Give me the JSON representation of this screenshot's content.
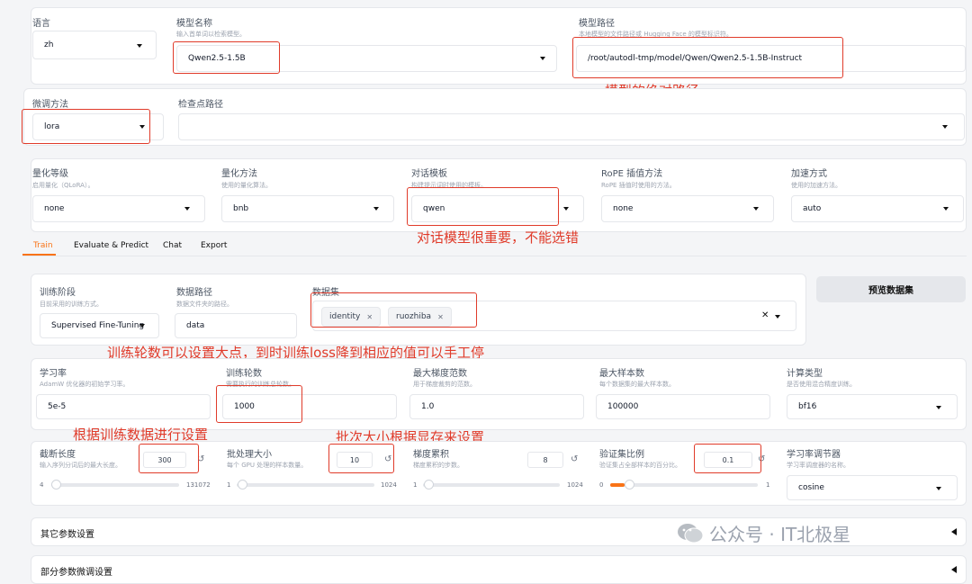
{
  "row1": {
    "lang_label": "语言",
    "lang_value": "zh",
    "model_name_label": "模型名称",
    "model_name_hint": "输入首单词以检索模型。",
    "model_name_value": "Qwen2.5-1.5B",
    "model_path_label": "模型路径",
    "model_path_hint": "本地模型的文件路径或 Hugging Face 的模型标识符。",
    "model_path_value": "/root/autodl-tmp/model/Qwen/Qwen2.5-1.5B-Instruct"
  },
  "row2": {
    "finetune_label": "微调方法",
    "finetune_value": "lora",
    "checkpoint_label": "检查点路径"
  },
  "row3": {
    "quant_label": "量化等级",
    "quant_hint": "启用量化（QLoRA）。",
    "quant_value": "none",
    "quant_method_label": "量化方法",
    "quant_method_hint": "使用的量化算法。",
    "quant_method_value": "bnb",
    "template_label": "对话模板",
    "template_hint": "构建提示词时使用的模板。",
    "template_value": "qwen",
    "rope_label": "RoPE 插值方法",
    "rope_hint": "RoPE 插值时使用的方法。",
    "rope_value": "none",
    "accel_label": "加速方式",
    "accel_hint": "使用的加速方法。",
    "accel_value": "auto"
  },
  "tabs": [
    "Train",
    "Evaluate & Predict",
    "Chat",
    "Export"
  ],
  "train": {
    "stage_label": "训练阶段",
    "stage_hint": "目前采用的训练方式。",
    "stage_value": "Supervised Fine-Tuning",
    "data_dir_label": "数据路径",
    "data_dir_hint": "数据文件夹的路径。",
    "data_dir_value": "data",
    "dataset_label": "数据集",
    "datasets": [
      "identity",
      "ruozhiba"
    ],
    "preview_button": "预览数据集"
  },
  "params": {
    "lr_label": "学习率",
    "lr_hint": "AdamW 优化器的初始学习率。",
    "lr_value": "5e-5",
    "epochs_label": "训练轮数",
    "epochs_hint": "需要执行的训练总轮数。",
    "epochs_value": "1000",
    "grad_norm_label": "最大梯度范数",
    "grad_norm_hint": "用于梯度裁剪的范数。",
    "grad_norm_value": "1.0",
    "max_samples_label": "最大样本数",
    "max_samples_hint": "每个数据集的最大样本数。",
    "max_samples_value": "100000",
    "compute_label": "计算类型",
    "compute_hint": "是否使用混合精度训练。",
    "compute_value": "bf16"
  },
  "sliders": {
    "cutoff_label": "截断长度",
    "cutoff_hint": "输入序列分词后的最大长度。",
    "cutoff_value": "300",
    "cutoff_min": "4",
    "cutoff_max": "131072",
    "cutoff_fraction": 0.002,
    "batch_label": "批处理大小",
    "batch_hint": "每个 GPU 处理的样本数量。",
    "batch_value": "10",
    "batch_min": "1",
    "batch_max": "1024",
    "batch_fraction": 0.009,
    "grad_acc_label": "梯度累积",
    "grad_acc_hint": "梯度累积的步数。",
    "grad_acc_value": "8",
    "grad_acc_min": "1",
    "grad_acc_max": "1024",
    "grad_acc_fraction": 0.007,
    "val_label": "验证集比例",
    "val_hint": "验证集占全部样本的百分比。",
    "val_value": "0.1",
    "val_min": "0",
    "val_max": "1",
    "val_fraction": 0.1,
    "sched_label": "学习率调节器",
    "sched_hint": "学习率调度器的名称。",
    "sched_value": "cosine"
  },
  "accordions": [
    "其它参数设置",
    "部分参数微调设置"
  ],
  "annotations": {
    "abs_path": "模型的绝对路径",
    "template": "对话模型很重要，不能选错",
    "epochs": "训练轮数可以设置大点，到时训练loss降到相应的值可以手工停",
    "cutoff": "根据训练数据进行设置",
    "batch": "批次大小根据显存来设置"
  },
  "watermark": "公众号 · IT北极星",
  "accent_color": "#f97316",
  "annotation_color": "#e03b2a"
}
